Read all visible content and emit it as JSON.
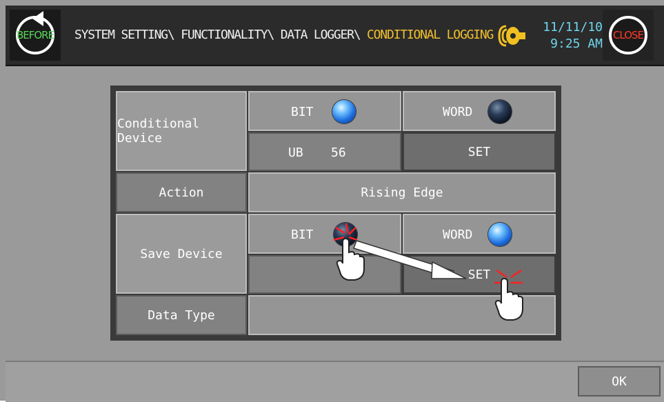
{
  "header": {
    "before_label": "BEFORE",
    "close_label": "CLOSE",
    "breadcrumb_path": "SYSTEM SETTING\\ FUNCTIONALITY\\ DATA LOGGER\\ ",
    "breadcrumb_current": "CONDITIONAL LOGGING",
    "date": "11/11/10",
    "time": "9:25 AM",
    "alarm_icon": "alarm-bell-icon"
  },
  "table": {
    "conditional_device_label": "Conditional Device",
    "cd_bit_label": "BIT",
    "cd_word_label": "WORD",
    "cd_device_type": "UB",
    "cd_device_address": "56",
    "cd_set_label": "SET",
    "action_label": "Action",
    "action_value": "Rising Edge",
    "save_device_label": "Save Device",
    "sd_bit_label": "BIT",
    "sd_word_label": "WORD",
    "sd_set_label": "SET",
    "data_type_label": "Data Type"
  },
  "state": {
    "cd_bit_selected": true,
    "cd_word_selected": false,
    "sd_bit_selected": false,
    "sd_word_selected": true
  },
  "footer": {
    "ok_label": "OK"
  },
  "colors": {
    "header_bg": "#2b2b2b",
    "breadcrumb_current": "#f2c02c",
    "datetime": "#6fd6ec",
    "before": "#58d858",
    "close": "#ff3a2a",
    "led_on": "#1d6fe0",
    "panel_bg": "#8f8f8f",
    "highlight": "#ff2020"
  }
}
